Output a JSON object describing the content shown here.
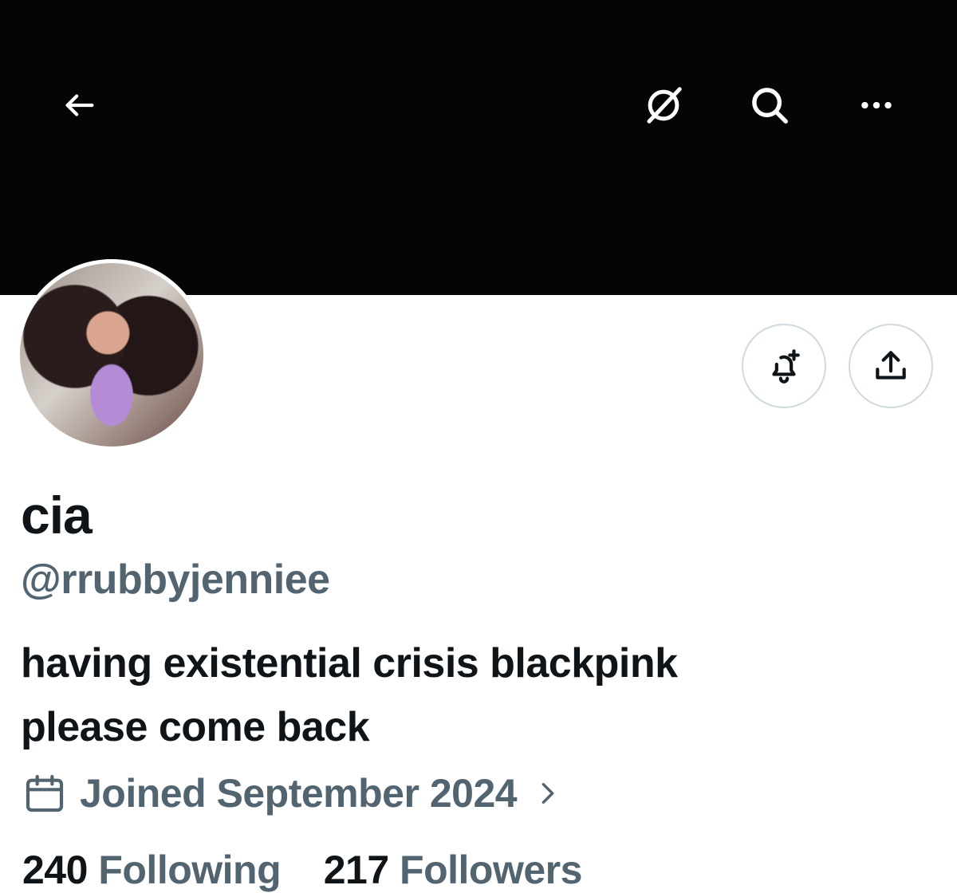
{
  "header": {
    "back_icon": "arrow-left-icon",
    "grok_icon": "grok-icon",
    "search_icon": "search-icon",
    "more_icon": "more-icon"
  },
  "profile": {
    "display_name": "cia",
    "handle": "@rrubbyjenniee",
    "bio_line1": "having existential crisis blackpink",
    "bio_line2": "please come back",
    "joined": "Joined September 2024"
  },
  "actions": {
    "notify_icon": "bell-plus-icon",
    "share_icon": "share-icon"
  },
  "stats": {
    "following_count": "240",
    "following_label": "Following",
    "followers_count": "217",
    "followers_label": "Followers"
  },
  "colors": {
    "banner": "#050505",
    "text": "#0f1419",
    "muted": "#536471",
    "border": "#cfd9de"
  }
}
